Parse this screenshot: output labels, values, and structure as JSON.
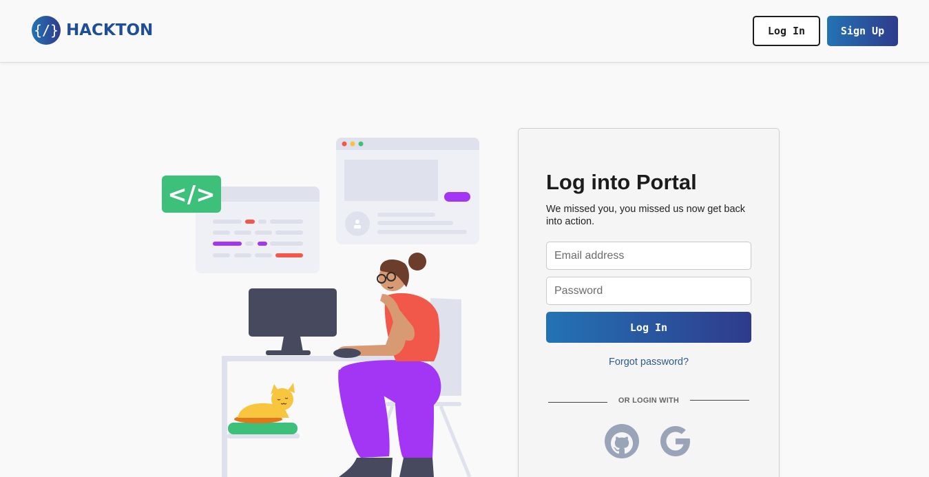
{
  "header": {
    "brand": "HACKTON",
    "login_label": "Log In",
    "signup_label": "Sign Up"
  },
  "card": {
    "title": "Log into Portal",
    "subtitle": "We missed you, you missed us now get back into action.",
    "email_placeholder": "Email address",
    "password_placeholder": "Password",
    "login_label": "Log In",
    "forgot_label": "Forgot password?",
    "divider_label": "OR LOGIN WITH",
    "social": [
      "github-icon",
      "google-icon"
    ]
  },
  "colors": {
    "brand": "#1f4e96",
    "button_gradient_start": "#2373b4",
    "button_gradient_end": "#2f3b8c",
    "code_badge": "#3cc07a",
    "accent_purple": "#a335f5",
    "accent_red": "#f2584a"
  }
}
